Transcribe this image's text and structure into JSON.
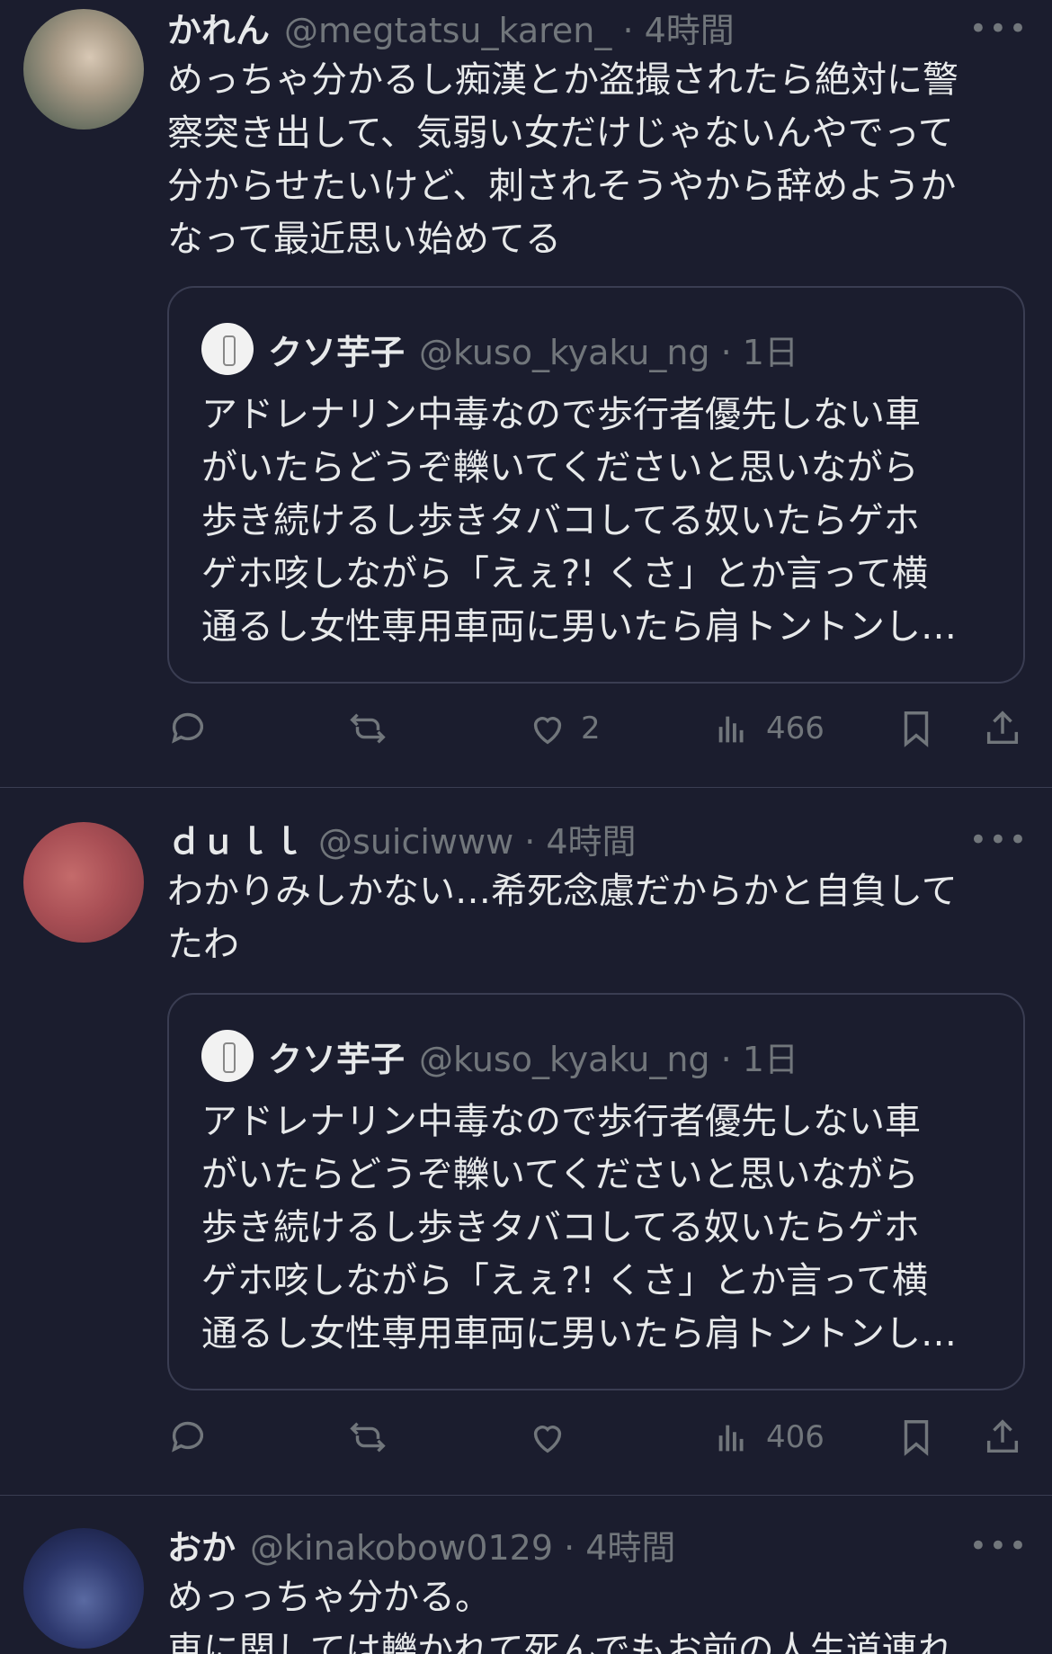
{
  "tweets": [
    {
      "name": "かれん",
      "handle": "@megtatsu_karen_ · 4時間",
      "text": "めっちゃ分かるし痴漢とか盗撮されたら絶対に警\n察突き出して、気弱い女だけじゃないんやでって\n分からせたいけど、刺されそうやから辞めようか\nなって最近思い始めてる",
      "quote": {
        "name": "クソ芋子",
        "handle": "@kuso_kyaku_ng · 1日",
        "text": "アドレナリン中毒なので歩行者優先しない車\nがいたらどうぞ轢いてくださいと思いながら\n歩き続けるし歩きタバコしてる奴いたらゲホ\nゲホ咳しながら「えぇ?! くさ」とか言って横\n通るし女性専用車両に男いたら肩トントンし…"
      },
      "likes": "2",
      "views": "466"
    },
    {
      "name": "ｄｕｌｌ",
      "handle": "@suiciwww · 4時間",
      "text": "わかりみしかない…希死念慮だからかと自負して\nたわ",
      "quote": {
        "name": "クソ芋子",
        "handle": "@kuso_kyaku_ng · 1日",
        "text": "アドレナリン中毒なので歩行者優先しない車\nがいたらどうぞ轢いてくださいと思いながら\n歩き続けるし歩きタバコしてる奴いたらゲホ\nゲホ咳しながら「えぇ?! くさ」とか言って横\n通るし女性専用車両に男いたら肩トントンし…"
      },
      "likes": "",
      "views": "406"
    },
    {
      "name": "おか",
      "handle": "@kinakobow0129 · 4時間",
      "text": "めっっちゃ分かる。\n車に関しては轢かれて死んでもお前の人生道連れ"
    }
  ],
  "more_label": "•••",
  "icons": [
    "reply-icon",
    "retweet-icon",
    "like-icon",
    "views-icon",
    "bookmark-icon",
    "share-icon"
  ],
  "colors": {
    "background": "#1b1d2e",
    "text": "#e7e9ea",
    "muted": "#71767b",
    "border": "#3a3d52"
  }
}
